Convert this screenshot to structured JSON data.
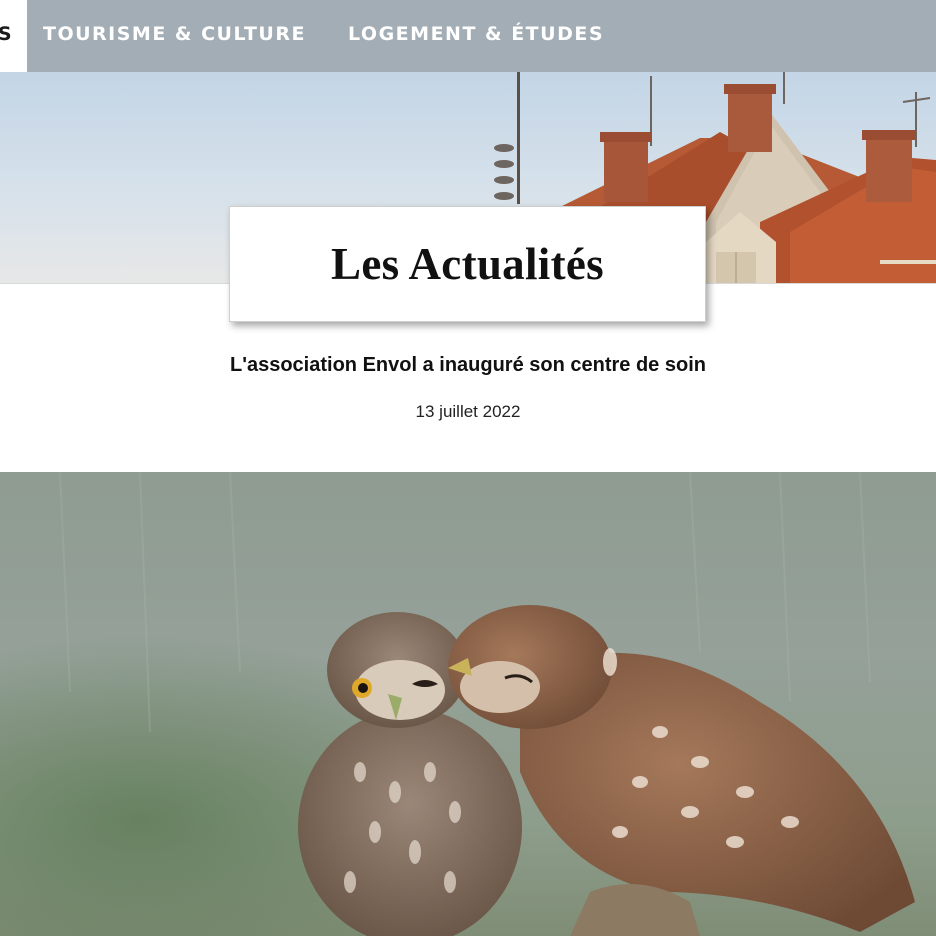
{
  "nav": {
    "active_partial": "S",
    "items": [
      "TOURISME & CULTURE",
      "LOGEMENT & ÉTUDES"
    ]
  },
  "hero": {
    "image": "town-rooftops-banner"
  },
  "page_title": "Les Actualités",
  "article": {
    "title": "L'association Envol a inauguré son centre de soin",
    "date": "13 juillet 2022",
    "image": "two-little-owls-photo"
  },
  "colors": {
    "nav_bg": "#a3adb5",
    "nav_text": "#ffffff",
    "title_text": "#111111",
    "page_bg": "#ffffff"
  }
}
